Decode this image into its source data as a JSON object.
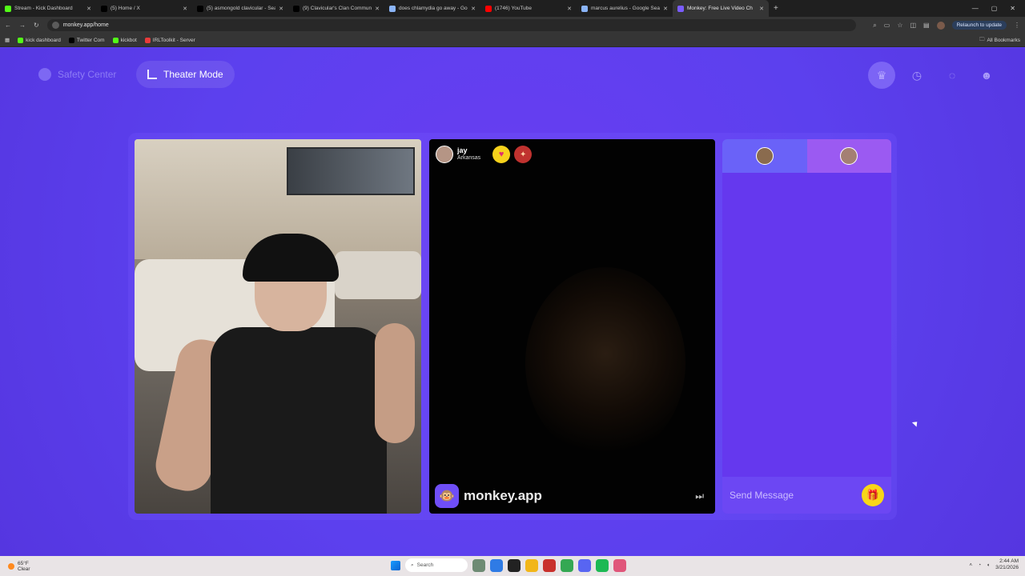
{
  "browser": {
    "tabs": [
      {
        "title": "Stream - Kick Dashboard",
        "color": "#53fc18",
        "active": false
      },
      {
        "title": "(5) Home / X",
        "color": "#000000",
        "active": false
      },
      {
        "title": "(5) asmongold clavicular - Sear",
        "color": "#000000",
        "active": false
      },
      {
        "title": "(9) Clavicular's Clan Communit",
        "color": "#000000",
        "active": false
      },
      {
        "title": "does chlamydia go away - Goo",
        "color": "#8ab4f8",
        "active": false
      },
      {
        "title": "(1746) YouTube",
        "color": "#ff0000",
        "active": false
      },
      {
        "title": "marcus aurelius - Google Sear",
        "color": "#8ab4f8",
        "active": false
      },
      {
        "title": "Monkey: Free Live Video Ch",
        "color": "#7a5cff",
        "active": true
      }
    ],
    "url": "monkey.app/home",
    "relaunch_label": "Relaunch to update",
    "bookmarks": [
      {
        "label": "kick dashboard",
        "color": "#53fc18"
      },
      {
        "label": "Twitter Com",
        "color": "#000000"
      },
      {
        "label": "kickbot",
        "color": "#53fc18"
      },
      {
        "label": "IRLToolkit - Server",
        "color": "#e83b3b"
      }
    ],
    "all_bookmarks_label": "All Bookmarks"
  },
  "header": {
    "safety_center": "Safety Center",
    "theater_mode": "Theater Mode"
  },
  "remote_user": {
    "name": "jay",
    "location": "Arkansas"
  },
  "brand": {
    "name": "monkey.app"
  },
  "chat": {
    "placeholder": "Send Message"
  },
  "taskbar": {
    "temp": "65°F",
    "weather": "Clear",
    "search_label": "Search",
    "time": "2:44 AM",
    "date": "3/21/2026"
  },
  "colors": {
    "accent": "#5b3ff0",
    "gift": "#f8d718"
  }
}
